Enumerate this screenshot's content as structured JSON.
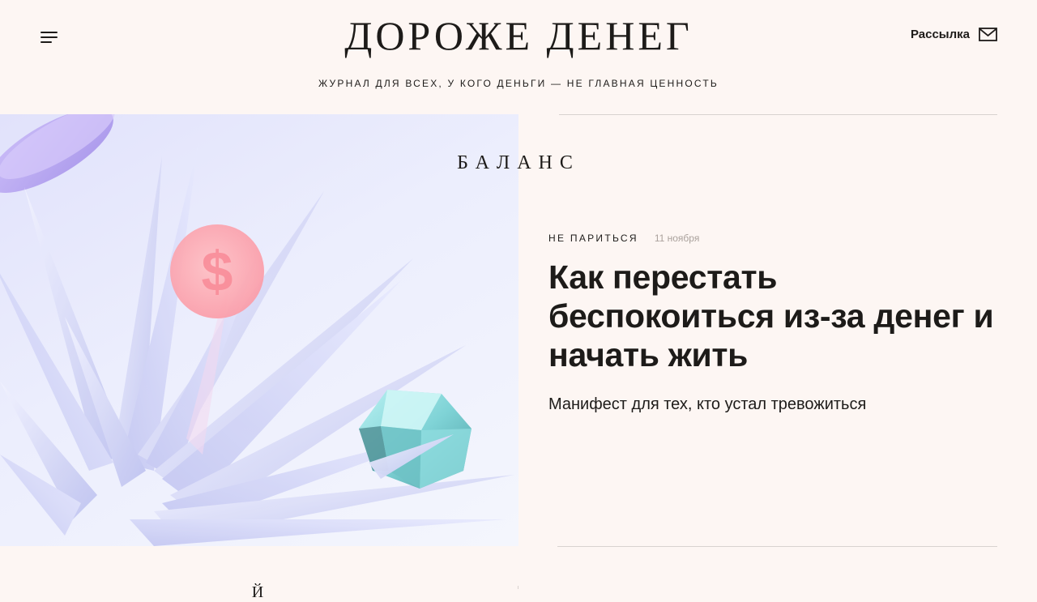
{
  "header": {
    "logo": "ДОРОЖЕ ДЕНЕГ",
    "tagline": "ЖУРНАЛ ДЛЯ ВСЕХ, У КОГО ДЕНЬГИ — НЕ ГЛАВНАЯ ЦЕННОСТЬ",
    "menu_icon": "hamburger-icon",
    "newsletter_label": "Рассылка",
    "newsletter_icon": "envelope-icon"
  },
  "hero": {
    "section_label": "БАЛАНС",
    "category": "НЕ ПАРИТЬСЯ",
    "date": "11 ноября",
    "title": "Как перестать беспокоиться из-за денег и начать жить",
    "lead": "Манифест для тех, кто устал тревожиться",
    "image_description_icons": [
      "crystal-spikes",
      "dollar-coin",
      "diamond",
      "purple-disc"
    ]
  },
  "below": {
    "heading_fragment": "Й"
  },
  "colors": {
    "background": "#fdf6f3",
    "text": "#1d1b19",
    "muted": "#aaa19c",
    "rule": "#d8d2cf"
  }
}
